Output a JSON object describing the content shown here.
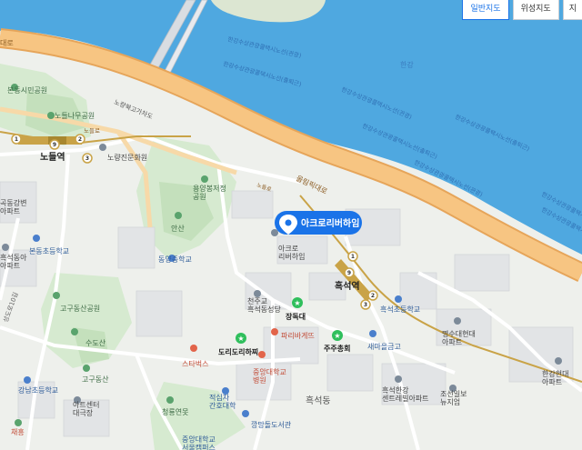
{
  "map_type_buttons": [
    {
      "label": "일반지도",
      "active": true
    },
    {
      "label": "위성지도",
      "active": false
    },
    {
      "label": "지",
      "active": false
    }
  ],
  "water_labels": {
    "river": "한강",
    "tour_route_1": "한강수상관광콜택시노선(관광)",
    "tour_route_2": "한강수상관광콜택시노선(출퇴근)",
    "tour_route_3": "한강수상관광콜택시노선(관광)",
    "tour_route_4": "한강수상관광콜택시노선(출퇴근)",
    "tour_route_5": "한강수상관광콜택시노선(관광)",
    "tour_route_6": "한강수상관광콜택시노선(출퇴근)",
    "tour_route_7": "한강수상관광콜택시노선(관광)",
    "tour_route_8": "한강수상관광콜택시노선(출퇴근)"
  },
  "road_labels": {
    "gangbyeon_left": "대로",
    "gangbyeon": "올림픽대로",
    "nodeul_bridge": "노량북고가차도",
    "nodeul_road": "노들로",
    "small_road_1": "노들로",
    "saetgang_left": "성도로10길"
  },
  "selected_place": {
    "name": "아크로리버하임",
    "pin_icon": "map-pin-icon",
    "color": "#1a73e8"
  },
  "stations": {
    "nodeul": {
      "name": "노들역",
      "lines": [
        "1",
        "9",
        "2",
        "3"
      ]
    },
    "heukseok": {
      "name": "흑석역",
      "lines": [
        "1",
        "9",
        "2",
        "3"
      ]
    }
  },
  "pois": {
    "bondong_park": "본동시민공원",
    "nodeul_tree_park": "노들나무공원",
    "noryangjin_park": "노량진문화원",
    "yongyang_park": "용양봉저정\n공원",
    "ansan": "안산",
    "dongyang_middle": "동양중학교",
    "bondong_elementary": "본동초등학교",
    "goguidong_park": "고구동산공원",
    "susan": "수도산",
    "gogudongsan": "고구동산",
    "gangnam_elementary": "강남초등학교",
    "artcenter": "아트센터\n대극장",
    "cheongryong": "청룡연못",
    "jeokseong_hospital": "적십자\n간호대학",
    "kkaengmugu": "깡망돌도서관",
    "chungang_univ": "중앙대학교\n서울캠퍼스",
    "chungang_hospital": "중앙대학교\n병원",
    "starbucks": "스타벅스",
    "paris_baguette": "파리바게뜨",
    "jangdokdae": "장독대",
    "dori_dori": "도리도리하찌",
    "juju": "주주총회",
    "cheonjugyo": "천주교\n흑석동성당",
    "acro_building": "아크로\n리버하임",
    "saemaeul": "새마을금고",
    "heukseok_elementary": "흑석초등학교",
    "myeongsu_apt": "명수대현대\n아파트",
    "hangang_hyundai": "한강현대\n아파트",
    "heukseok_hangang": "흑석한강\n센트레빌아파트",
    "joseon_ilbo": "조선일보\n뉴지엄",
    "heukseok_dong": "흑석동",
    "heukseok_apt_left": "흑석동아\n아파트",
    "heukseok_apt_left2": "아파트",
    "gangbyeon_apt": "곡동강변\n아파트",
    "chaeseung": "채흥",
    "nodeul_square": "노들역"
  },
  "colors": {
    "water": "#4fa8e0",
    "road_major": "#f7c582",
    "road_major_edge": "#e6a55a",
    "park": "#d6ead0",
    "park_dark": "#c4e0bc",
    "land": "#eef0ec",
    "block": "#e2e4e6",
    "block_edge": "#d2d5d9",
    "pin": "#1a73e8",
    "poi_green": "#5aa36d",
    "poi_blue": "#4a7fcc",
    "poi_red": "#e2644a",
    "station_line": "#c9a347"
  }
}
